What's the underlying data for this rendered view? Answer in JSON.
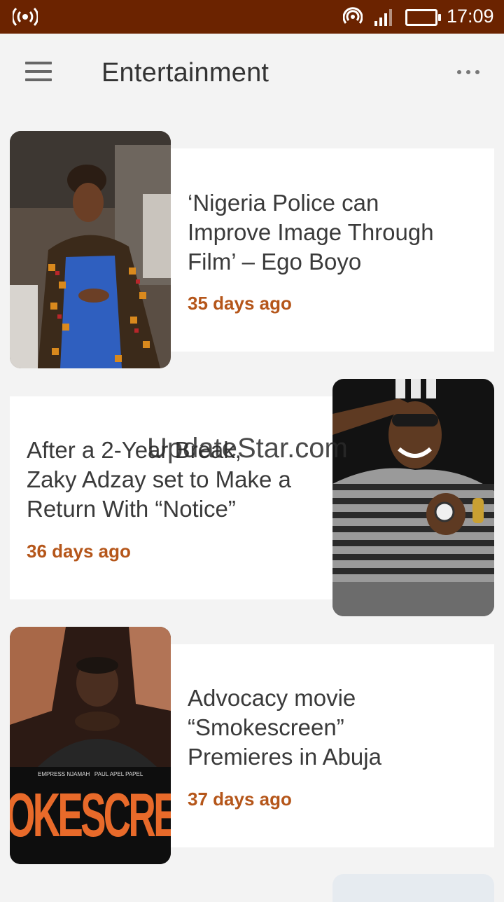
{
  "status_bar": {
    "time": "17:09"
  },
  "header": {
    "title": "Entertainment"
  },
  "articles": [
    {
      "headline_lines": [
        "‘Nigeria Police can",
        "Improve Image Through",
        "Film’ – Ego Boyo"
      ],
      "age": "35 days ago"
    },
    {
      "headline_lines": [
        "After a 2-Year Break,",
        "Zaky Adzay set to Make a",
        "Return With “Notice”"
      ],
      "age": "36 days ago"
    },
    {
      "headline_lines": [
        "Advocacy movie",
        "“Smokescreen”",
        "Premieres in Abuja"
      ],
      "age": "37 days ago",
      "poster_credits": "EMPRESS NJAMAH   PAUL APEL PAPEL",
      "poster_title": "OKESCRE"
    }
  ],
  "watermark": "UpdateStar.com",
  "colors": {
    "status_bar": "#6b2300",
    "accent_age": "#b5561a",
    "background": "#f3f3f3"
  }
}
